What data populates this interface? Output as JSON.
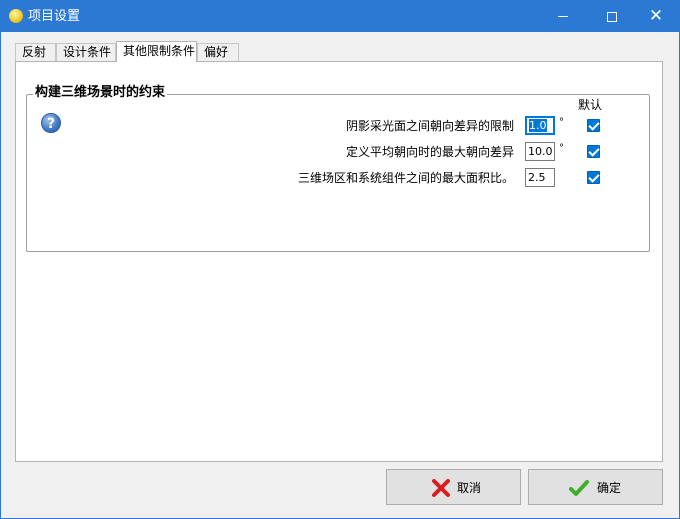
{
  "window": {
    "title": "项目设置",
    "title_bar_color": "#2b79d3"
  },
  "titlebar_buttons": {
    "close_glyph": "✕"
  },
  "tabs": [
    {
      "label": "反射",
      "active": false
    },
    {
      "label": "设计条件",
      "active": false
    },
    {
      "label": "其他限制条件",
      "active": true
    },
    {
      "label": "偏好",
      "active": false
    }
  ],
  "panel": {
    "group_title": "构建三维场景时的约束",
    "help_icon": "question-circle-icon",
    "default_header": "默认",
    "rows": [
      {
        "label": "阴影采光面之间朝向差异的限制",
        "value": "1.0",
        "unit": "°",
        "default_checked": true,
        "focused": true
      },
      {
        "label": "定义平均朝向时的最大朝向差异",
        "value": "10.0",
        "unit": "°",
        "default_checked": true,
        "focused": false
      },
      {
        "label": "三维场区和系统组件之间的最大面积比。",
        "value": "2.5",
        "unit": "",
        "default_checked": true,
        "focused": false
      }
    ]
  },
  "buttons": {
    "cancel_label": "取消",
    "cancel_icon": "red-x-icon",
    "ok_label": "确定",
    "ok_icon": "green-check-icon"
  },
  "colors": {
    "accent": "#0078d7",
    "cancel_icon": "#d81e1e",
    "ok_icon": "#3fae2a"
  }
}
